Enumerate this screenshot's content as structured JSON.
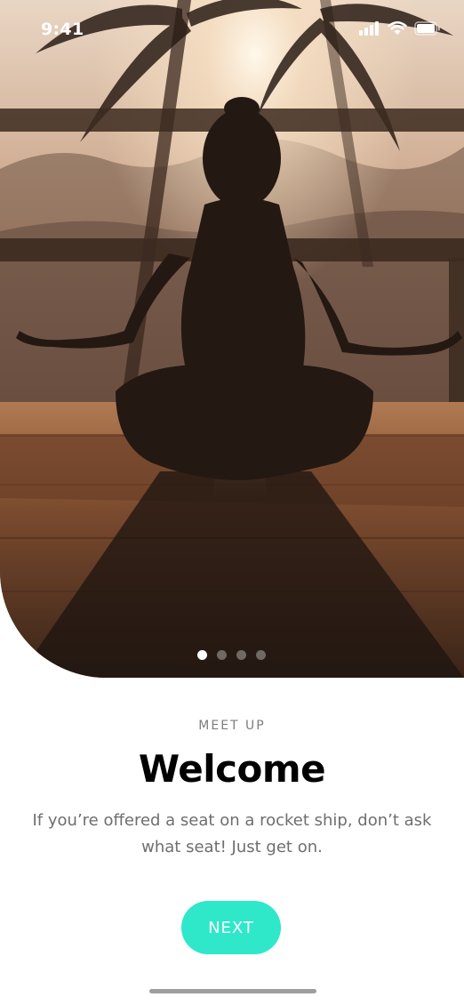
{
  "status_bar": {
    "time": "9:41",
    "icons": [
      "signal-icon",
      "wifi-icon",
      "battery-icon"
    ]
  },
  "hero": {
    "image": "meditation-sunset-photo",
    "carousel": {
      "count": 4,
      "active_index": 0
    }
  },
  "content": {
    "eyebrow": "MEET UP",
    "title": "Welcome",
    "body": "If you’re offered a seat on a rocket ship, don’t ask what seat! Just get on."
  },
  "actions": {
    "next_label": "NEXT"
  },
  "colors": {
    "accent": "#2ee8c9",
    "eyebrow": "#7d7d7d",
    "body": "#6e6e6e",
    "title": "#000000"
  }
}
